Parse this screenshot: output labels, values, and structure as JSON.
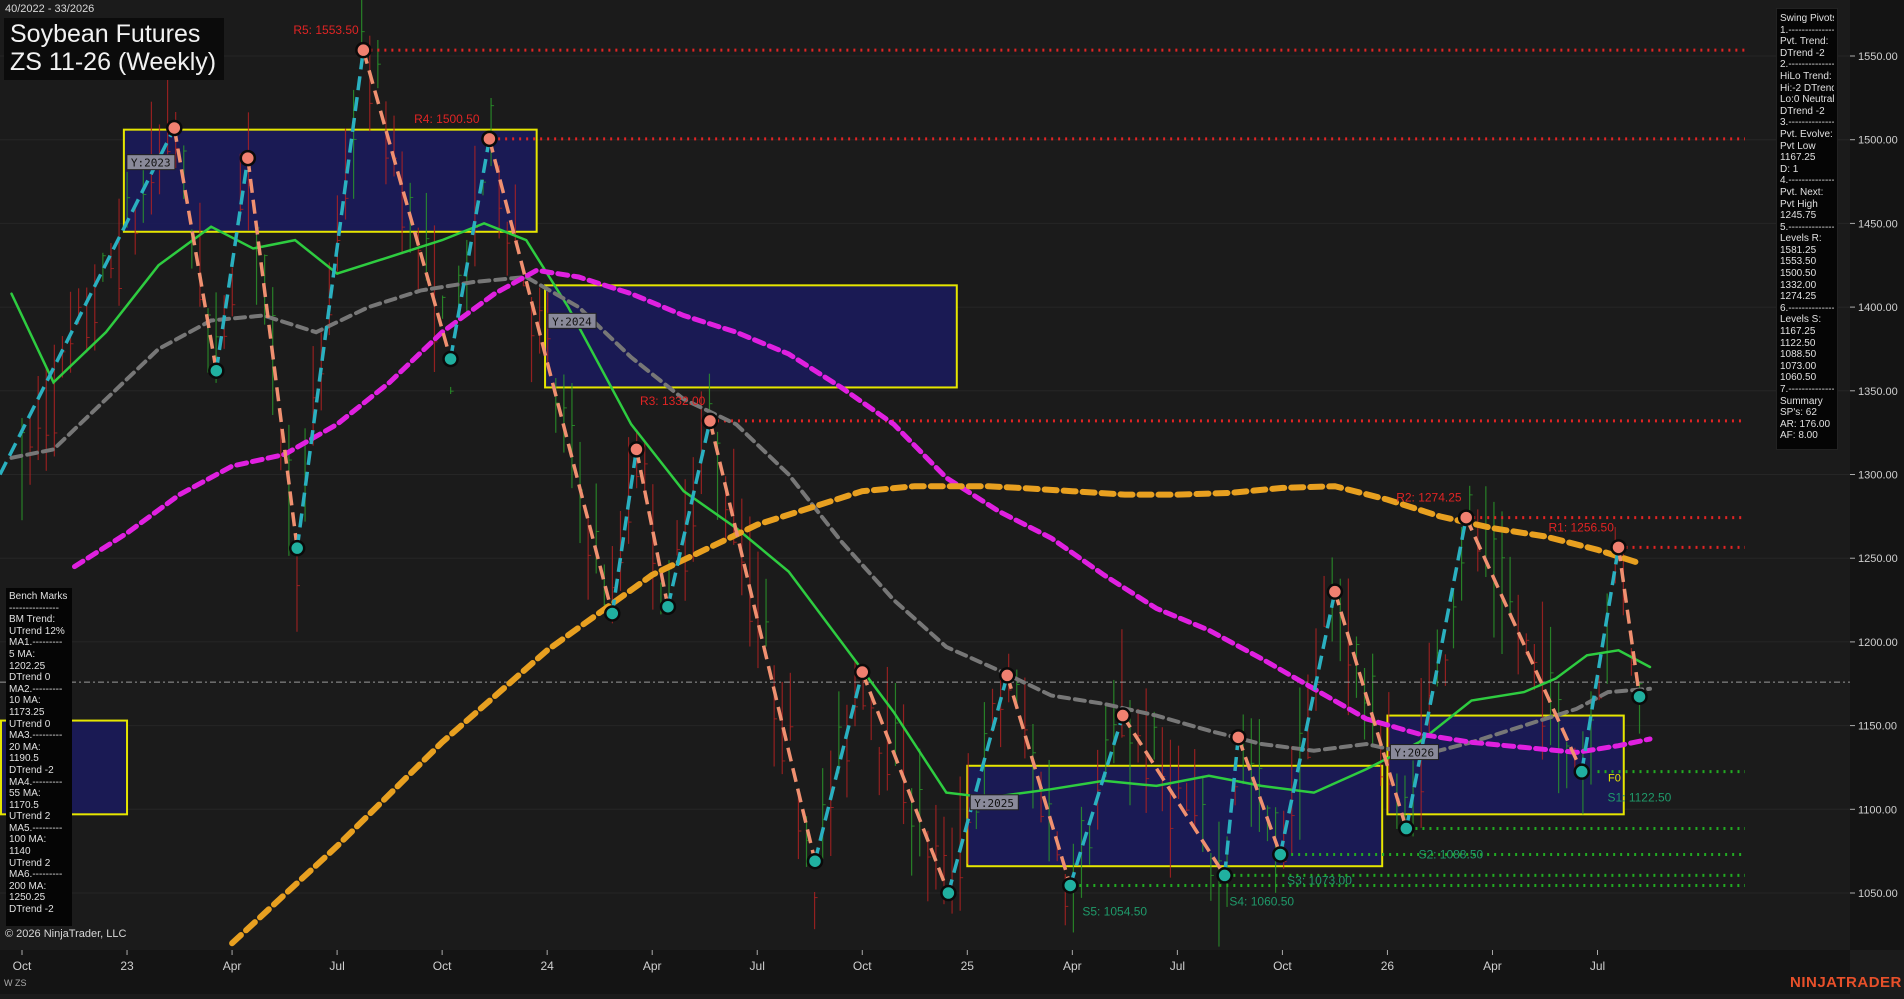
{
  "header": {
    "date_range": "40/2022 - 33/2026",
    "title": "Soybean Futures",
    "subtitle": "ZS 11-26 (Weekly)"
  },
  "footer": {
    "copyright": "© 2026 NinjaTrader, LLC",
    "symbol_label": "W ZS",
    "brand": "NINJATRADER"
  },
  "swing_pivots_panel": {
    "lines": [
      "Swing Pivots",
      "1.---------------",
      "Pvt. Trend:",
      "DTrend -2",
      "2.---------------",
      "HiLo Trend:",
      "Hi:-2 DTrend",
      "Lo:0 Neutral",
      "DTrend -2",
      "3.---------------",
      "Pvt. Evolve:",
      "Pvt Low",
      "1167.25",
      "D: 1",
      "4.---------------",
      "Pvt. Next:",
      "Pvt High",
      "1245.75",
      "5.---------------",
      "Levels R:",
      "1581.25",
      "1553.50",
      "1500.50",
      "1332.00",
      "1274.25",
      "6.---------------",
      "Levels S:",
      "1167.25",
      "1122.50",
      "1088.50",
      "1073.00",
      "1060.50",
      "7.---------------",
      "Summary",
      "SP's: 62",
      "AR: 176.00",
      "AF: 8.00"
    ]
  },
  "bench_marks_panel": {
    "lines": [
      "Bench Marks",
      "---------------",
      "BM Trend:",
      "UTrend 12%",
      "MA1.---------",
      "5 MA:",
      "1202.25",
      "DTrend 0",
      "MA2.---------",
      "10 MA:",
      "1173.25",
      "UTrend 0",
      "MA3.---------",
      "20 MA:",
      "1190.5",
      "DTrend -2",
      "MA4.---------",
      "55 MA:",
      "1170.5",
      "UTrend 2",
      "MA5.---------",
      "100 MA:",
      "1140",
      "UTrend 2",
      "MA6.---------",
      "200 MA:",
      "1250.25",
      "DTrend -2"
    ]
  },
  "colors": {
    "background": "#1b1b1b",
    "resistance": "#e02424",
    "support": "#22aa22",
    "support_label": "#1f9a6a",
    "ma_green": "#2ecc40",
    "ma_gray": "#777777",
    "ma_magenta": "#e020e0",
    "ma_orange": "#e8a020",
    "zone_fill": "#1a1a5e",
    "zone_border": "#e6e600",
    "swing_up": "#2ab0c0",
    "swing_down": "#f09070",
    "pivot_teal": "#20b0a0",
    "pivot_salmon": "#f08070"
  },
  "chart_data": {
    "type": "line",
    "title": "Soybean Futures",
    "subtitle": "ZS 11-26 (Weekly)",
    "yaxis_side": "right",
    "ylim": [
      1020,
      1580
    ],
    "yticks": [
      1050,
      1100,
      1150,
      1200,
      1250,
      1300,
      1350,
      1400,
      1450,
      1500,
      1550
    ],
    "ytick_labels": [
      "1050.00",
      "1100.00",
      "1150.00",
      "1200.00",
      "1250.00",
      "1300.00",
      "1350.00",
      "1400.00",
      "1450.00",
      "1500.00",
      "1550.00"
    ],
    "xlim": [
      -0.1,
      15.6
    ],
    "xticks": [
      {
        "pos": 0,
        "label": "Oct"
      },
      {
        "pos": 1,
        "label": "23"
      },
      {
        "pos": 2,
        "label": "Apr"
      },
      {
        "pos": 3,
        "label": "Jul"
      },
      {
        "pos": 4,
        "label": "Oct"
      },
      {
        "pos": 5,
        "label": "24"
      },
      {
        "pos": 6,
        "label": "Apr"
      },
      {
        "pos": 7,
        "label": "Jul"
      },
      {
        "pos": 8,
        "label": "Oct"
      },
      {
        "pos": 9,
        "label": "25"
      },
      {
        "pos": 10,
        "label": "Apr"
      },
      {
        "pos": 11,
        "label": "Jul"
      },
      {
        "pos": 12,
        "label": "Oct"
      },
      {
        "pos": 13,
        "label": "26"
      },
      {
        "pos": 14,
        "label": "Apr"
      },
      {
        "pos": 15,
        "label": "Jul"
      }
    ],
    "current_price": 1176,
    "resistance_levels": [
      {
        "name": "R5: 1553.50",
        "value": 1553.5,
        "x_start": 3.25
      },
      {
        "name": "R4: 1500.50",
        "value": 1500.5,
        "x_start": 4.4
      },
      {
        "name": "R3: 1332.00",
        "value": 1332,
        "x_start": 6.55
      },
      {
        "name": "R2: 1274.25",
        "value": 1274.25,
        "x_start": 13.75
      },
      {
        "name": "R1: 1256.50",
        "value": 1256.5,
        "x_start": 15.2
      }
    ],
    "support_levels": [
      {
        "name": "S1: 1122.50",
        "value": 1122.5,
        "x_start": 15.0
      },
      {
        "name": "S2: 1088.50",
        "value": 1088.5,
        "x_start": 13.2
      },
      {
        "name": "S3: 1073.00",
        "value": 1073,
        "x_start": 11.95
      },
      {
        "name": "S4: 1060.50",
        "value": 1060.5,
        "x_start": 11.4
      },
      {
        "name": "S5: 1054.50",
        "value": 1054.5,
        "x_start": 10.0
      }
    ],
    "resistance_label_list": [
      "R5: 1553.50",
      "R4: 1500.50",
      "R3: 1332.00",
      "R2: 1274.25",
      "R1: 1256.50"
    ],
    "support_label_list": [
      "S1: 1122.50",
      "S2: 1088.50",
      "S3: 1073.00",
      "S4: 1060.50",
      "S5: 1054.50"
    ],
    "fib_marker": "F0",
    "yearly_zones": [
      {
        "label": "Y:2023",
        "x0": 0.97,
        "x1": 4.9,
        "y_low": 1445,
        "y_high": 1506
      },
      {
        "label": "Y:2024",
        "x0": 4.98,
        "x1": 8.9,
        "y_low": 1352,
        "y_high": 1413
      },
      {
        "label": "Y:2025",
        "x0": 9.0,
        "x1": 12.95,
        "y_low": 1066,
        "y_high": 1126
      },
      {
        "label": "Y:2026",
        "x0": 13.0,
        "x1": 15.25,
        "y_low": 1097,
        "y_high": 1156
      },
      {
        "label": "",
        "x0": -0.2,
        "x1": 1.0,
        "y_low": 1097,
        "y_high": 1153
      }
    ],
    "swing_pivots": [
      {
        "x": 1.45,
        "y": 1507
      },
      {
        "x": 1.85,
        "y": 1362
      },
      {
        "x": 2.15,
        "y": 1489
      },
      {
        "x": 2.62,
        "y": 1256
      },
      {
        "x": 3.25,
        "y": 1553.5
      },
      {
        "x": 4.08,
        "y": 1369
      },
      {
        "x": 4.45,
        "y": 1500.5
      },
      {
        "x": 5.62,
        "y": 1217
      },
      {
        "x": 5.85,
        "y": 1315
      },
      {
        "x": 6.15,
        "y": 1221
      },
      {
        "x": 6.55,
        "y": 1332
      },
      {
        "x": 7.55,
        "y": 1069
      },
      {
        "x": 8.0,
        "y": 1182
      },
      {
        "x": 8.82,
        "y": 1050
      },
      {
        "x": 9.38,
        "y": 1180
      },
      {
        "x": 9.98,
        "y": 1054.5
      },
      {
        "x": 10.48,
        "y": 1156
      },
      {
        "x": 11.45,
        "y": 1060.5
      },
      {
        "x": 11.58,
        "y": 1143
      },
      {
        "x": 11.98,
        "y": 1073
      },
      {
        "x": 12.5,
        "y": 1230
      },
      {
        "x": 13.18,
        "y": 1088.5
      },
      {
        "x": 13.75,
        "y": 1274.25
      },
      {
        "x": 14.85,
        "y": 1122.5
      },
      {
        "x": 15.2,
        "y": 1256.5
      },
      {
        "x": 15.4,
        "y": 1167.25
      }
    ],
    "series": [
      {
        "label": "MA green",
        "points": [
          [
            -0.1,
            1408
          ],
          [
            0.3,
            1355
          ],
          [
            0.8,
            1385
          ],
          [
            1.3,
            1425
          ],
          [
            1.8,
            1448
          ],
          [
            2.2,
            1435
          ],
          [
            2.6,
            1440
          ],
          [
            3.0,
            1420
          ],
          [
            3.5,
            1430
          ],
          [
            4.0,
            1440
          ],
          [
            4.4,
            1450
          ],
          [
            4.8,
            1440
          ],
          [
            5.2,
            1400
          ],
          [
            5.8,
            1330
          ],
          [
            6.3,
            1290
          ],
          [
            6.8,
            1268
          ],
          [
            7.3,
            1242
          ],
          [
            7.8,
            1200
          ],
          [
            8.3,
            1158
          ],
          [
            8.8,
            1110
          ],
          [
            9.2,
            1107
          ],
          [
            9.8,
            1112
          ],
          [
            10.3,
            1117
          ],
          [
            10.8,
            1114
          ],
          [
            11.3,
            1120
          ],
          [
            11.8,
            1114
          ],
          [
            12.3,
            1110
          ],
          [
            12.8,
            1124
          ],
          [
            13.3,
            1140
          ],
          [
            13.8,
            1165
          ],
          [
            14.3,
            1170
          ],
          [
            14.6,
            1178
          ],
          [
            14.9,
            1192
          ],
          [
            15.2,
            1195
          ],
          [
            15.5,
            1185
          ]
        ]
      },
      {
        "label": "MA gray",
        "points": [
          [
            -0.1,
            1310
          ],
          [
            0.3,
            1315
          ],
          [
            0.8,
            1345
          ],
          [
            1.3,
            1375
          ],
          [
            1.8,
            1392
          ],
          [
            2.3,
            1395
          ],
          [
            2.8,
            1385
          ],
          [
            3.3,
            1400
          ],
          [
            3.8,
            1410
          ],
          [
            4.3,
            1415
          ],
          [
            4.8,
            1418
          ],
          [
            5.3,
            1400
          ],
          [
            5.8,
            1370
          ],
          [
            6.3,
            1345
          ],
          [
            6.8,
            1330
          ],
          [
            7.3,
            1300
          ],
          [
            7.8,
            1260
          ],
          [
            8.3,
            1225
          ],
          [
            8.8,
            1197
          ],
          [
            9.3,
            1183
          ],
          [
            9.8,
            1168
          ],
          [
            10.3,
            1163
          ],
          [
            10.8,
            1156
          ],
          [
            11.3,
            1147
          ],
          [
            11.8,
            1139
          ],
          [
            12.3,
            1135
          ],
          [
            12.8,
            1139
          ],
          [
            13.3,
            1132
          ],
          [
            13.8,
            1140
          ],
          [
            14.3,
            1150
          ],
          [
            14.8,
            1160
          ],
          [
            15.1,
            1170
          ],
          [
            15.5,
            1172
          ]
        ]
      },
      {
        "label": "MA magenta",
        "points": [
          [
            0.5,
            1245
          ],
          [
            1.0,
            1265
          ],
          [
            1.5,
            1288
          ],
          [
            2.0,
            1305
          ],
          [
            2.5,
            1312
          ],
          [
            3.0,
            1330
          ],
          [
            3.5,
            1355
          ],
          [
            4.0,
            1385
          ],
          [
            4.5,
            1408
          ],
          [
            4.9,
            1422
          ],
          [
            5.3,
            1418
          ],
          [
            5.8,
            1408
          ],
          [
            6.3,
            1395
          ],
          [
            6.8,
            1385
          ],
          [
            7.3,
            1372
          ],
          [
            7.8,
            1352
          ],
          [
            8.3,
            1330
          ],
          [
            8.8,
            1298
          ],
          [
            9.3,
            1278
          ],
          [
            9.8,
            1262
          ],
          [
            10.3,
            1240
          ],
          [
            10.8,
            1220
          ],
          [
            11.3,
            1207
          ],
          [
            11.8,
            1190
          ],
          [
            12.3,
            1172
          ],
          [
            12.8,
            1154
          ],
          [
            13.3,
            1145
          ],
          [
            13.8,
            1140
          ],
          [
            14.3,
            1137
          ],
          [
            14.8,
            1134
          ],
          [
            15.2,
            1138
          ],
          [
            15.5,
            1142
          ]
        ]
      },
      {
        "label": "MA orange",
        "points": [
          [
            2.0,
            1020
          ],
          [
            3.0,
            1078
          ],
          [
            4.0,
            1140
          ],
          [
            5.0,
            1195
          ],
          [
            6.0,
            1240
          ],
          [
            7.0,
            1270
          ],
          [
            8.0,
            1290
          ],
          [
            8.5,
            1293
          ],
          [
            9.2,
            1293
          ],
          [
            9.5,
            1292
          ],
          [
            10.0,
            1290
          ],
          [
            10.5,
            1288
          ],
          [
            11.0,
            1288
          ],
          [
            11.5,
            1289
          ],
          [
            12.0,
            1292
          ],
          [
            12.5,
            1293
          ],
          [
            13.0,
            1285
          ],
          [
            13.5,
            1275
          ],
          [
            14.0,
            1268
          ],
          [
            14.5,
            1263
          ],
          [
            15.0,
            1255
          ],
          [
            15.4,
            1247
          ]
        ]
      }
    ]
  }
}
